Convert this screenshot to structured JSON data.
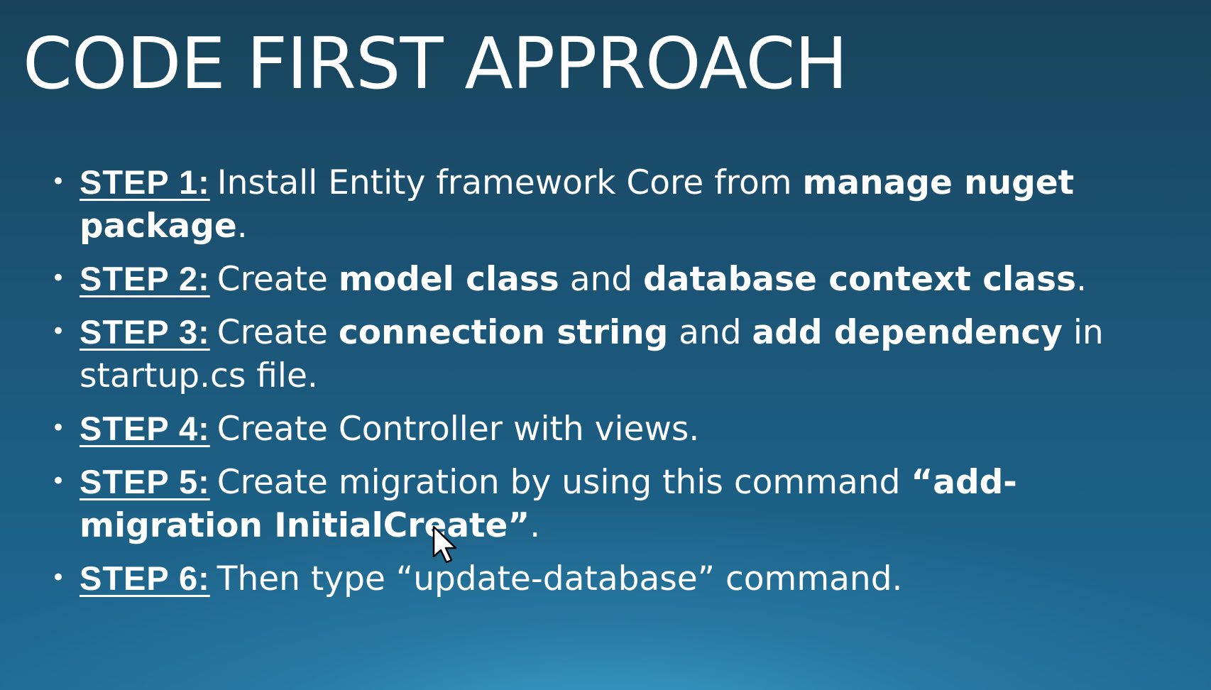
{
  "title": "CODE FIRST APPROACH",
  "steps": [
    {
      "label": "STEP 1:",
      "parts": [
        {
          "text": "Install Entity framework Core from ",
          "bold": false
        },
        {
          "text": "manage nuget package",
          "bold": true
        },
        {
          "text": ".",
          "bold": false
        }
      ]
    },
    {
      "label": "STEP 2:",
      "parts": [
        {
          "text": "Create ",
          "bold": false
        },
        {
          "text": "model class",
          "bold": true
        },
        {
          "text": " and ",
          "bold": false
        },
        {
          "text": "database context class",
          "bold": true
        },
        {
          "text": ".",
          "bold": false
        }
      ]
    },
    {
      "label": "STEP 3:",
      "parts": [
        {
          "text": "Create ",
          "bold": false
        },
        {
          "text": "connection string",
          "bold": true
        },
        {
          "text": " and ",
          "bold": false
        },
        {
          "text": "add dependency",
          "bold": true
        },
        {
          "text": " in startup.cs file.",
          "bold": false
        }
      ]
    },
    {
      "label": "STEP 4:",
      "parts": [
        {
          "text": "Create Controller with views.",
          "bold": false
        }
      ]
    },
    {
      "label": "STEP 5:",
      "parts": [
        {
          "text": "Create migration by using this command ",
          "bold": false
        },
        {
          "text": "“add-migration InitialCreate”",
          "bold": true
        },
        {
          "text": ".",
          "bold": false
        }
      ]
    },
    {
      "label": "STEP 6:",
      "parts": [
        {
          "text": "Then type “update-database” command.",
          "bold": false
        }
      ]
    }
  ],
  "bullet_char": "•",
  "icons": {
    "cursor": "mouse-pointer-icon"
  },
  "colors": {
    "background_top": "#18435a",
    "background_bottom": "#1f6a93",
    "glow": "#3ea4cf",
    "text": "#ffffff"
  }
}
